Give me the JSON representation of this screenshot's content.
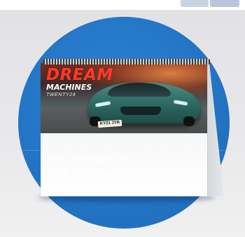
{
  "calendar": {
    "brand_line1": "DREAM",
    "brand_line2": "MACHINES",
    "brand_line3": "TWENTY24",
    "plate": "KY21 JYR"
  },
  "caption": {
    "line1": "Also available as",
    "line2": "desk. See page 33"
  },
  "colors": {
    "disc_blue": "#2475c6",
    "brand_red": "#ff3a28",
    "car_teal": "#2f6e66",
    "background_grey": "#e6e6e8"
  }
}
